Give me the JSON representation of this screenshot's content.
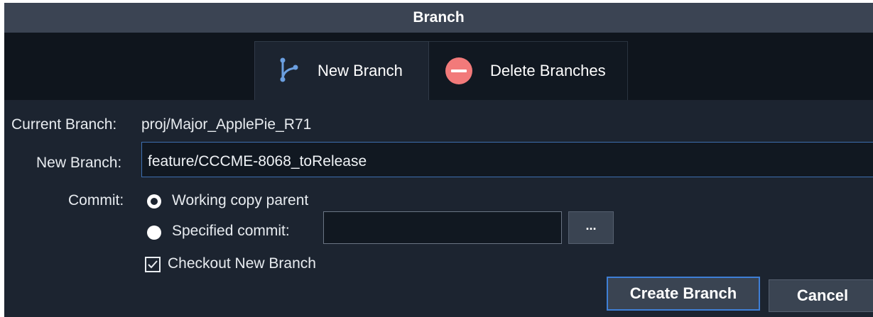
{
  "window": {
    "title": "Branch"
  },
  "tabs": [
    {
      "label": "New Branch",
      "icon": "branch-icon",
      "active": true
    },
    {
      "label": "Delete Branches",
      "icon": "minus-circle-icon",
      "active": false
    }
  ],
  "form": {
    "current_branch_label": "Current Branch:",
    "current_branch_value": "proj/Major_ApplePie_R71",
    "new_branch_label": "New Branch:",
    "new_branch_value": "feature/CCCME-8068_toRelease",
    "commit_label": "Commit:",
    "radio_options": [
      {
        "label": "Working copy parent",
        "selected": true
      },
      {
        "label": "Specified commit:",
        "selected": false
      }
    ],
    "specified_commit_value": "",
    "browse_label": "...",
    "checkout_label": "Checkout New Branch",
    "checkout_checked": true
  },
  "buttons": {
    "create_label": "Create Branch",
    "cancel_label": "Cancel"
  },
  "colors": {
    "background": "#1c2430",
    "titlebar": "#3b4453",
    "tab_strip": "#0f151d",
    "accent": "#3e7fd6",
    "delete_icon": "#f27a7a",
    "branch_icon": "#6b9fe0"
  }
}
